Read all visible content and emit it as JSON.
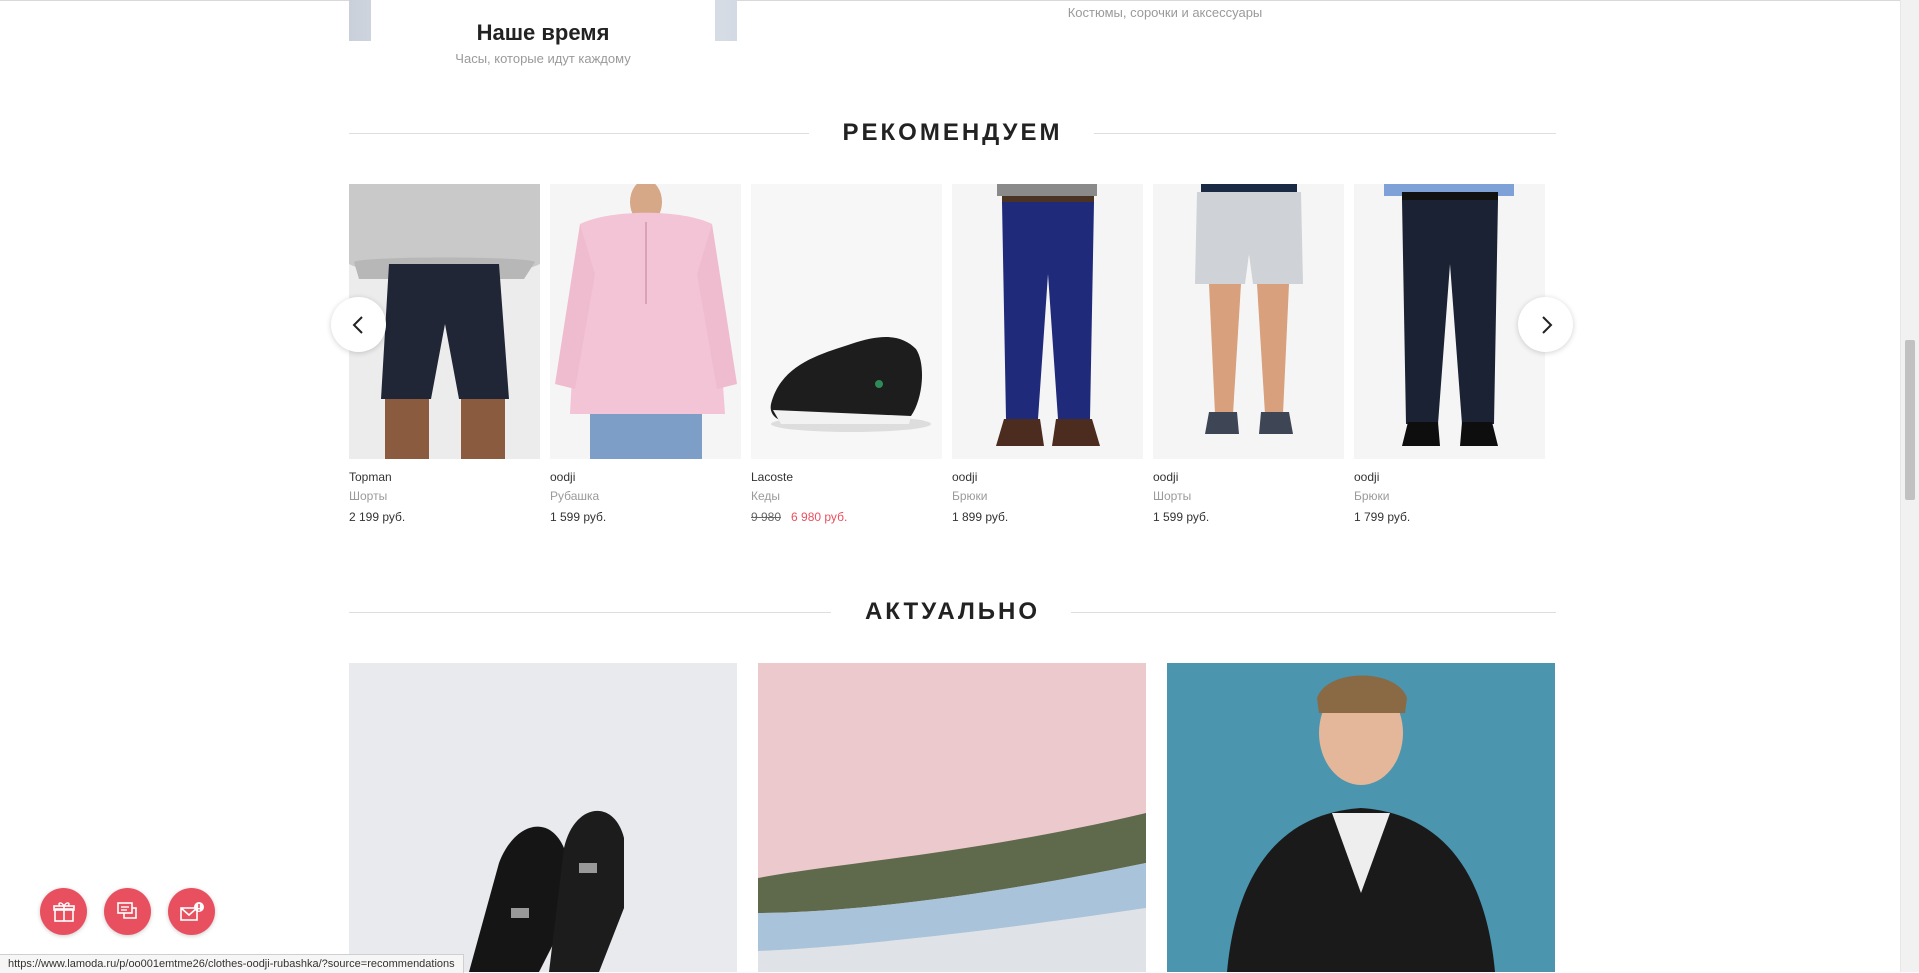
{
  "top": {
    "left_title": "Наше время",
    "left_subtitle": "Часы, которые идут каждому",
    "right_subtitle": "Костюмы, сорочки и аксессуары"
  },
  "recommend": {
    "title": "РЕКОМЕНДУЕМ",
    "products": [
      {
        "brand": "Topman",
        "category": "Шорты",
        "price": "2 199 руб."
      },
      {
        "brand": "oodji",
        "category": "Рубашка",
        "price": "1 599 руб."
      },
      {
        "brand": "Lacoste",
        "category": "Кеды",
        "old_price": "9 980",
        "price": "6 980 руб."
      },
      {
        "brand": "oodji",
        "category": "Брюки",
        "price": "1 899 руб."
      },
      {
        "brand": "oodji",
        "category": "Шорты",
        "price": "1 599 руб."
      },
      {
        "brand": "oodji",
        "category": "Брюки",
        "price": "1 799 руб."
      }
    ]
  },
  "actual": {
    "title": "АКТУАЛЬНО"
  },
  "status_url": "https://www.lamoda.ru/p/oo001emtme26/clothes-oodji-rubashka/?source=recommendations",
  "colors": {
    "accent": "#e9505f",
    "sale_price": "#e9505f"
  }
}
